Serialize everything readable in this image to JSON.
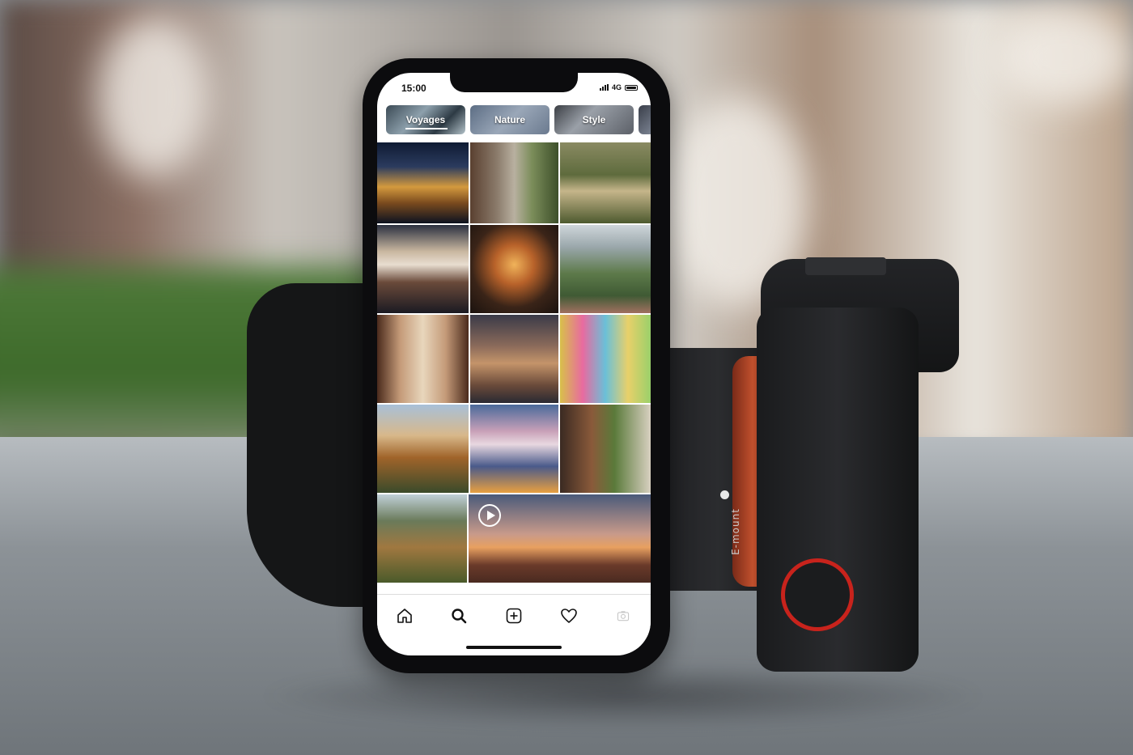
{
  "status_bar": {
    "time": "15:00",
    "network": "4G"
  },
  "topics": [
    {
      "label": "Voyages",
      "selected": true
    },
    {
      "label": "Nature",
      "selected": false
    },
    {
      "label": "Style",
      "selected": false
    },
    {
      "label": "",
      "selected": false
    }
  ],
  "grid": {
    "tiles": [
      {
        "name": "tile-1"
      },
      {
        "name": "tile-2"
      },
      {
        "name": "tile-3"
      },
      {
        "name": "tile-4"
      },
      {
        "name": "tile-5"
      },
      {
        "name": "tile-6"
      },
      {
        "name": "tile-7"
      },
      {
        "name": "tile-8"
      },
      {
        "name": "tile-9"
      },
      {
        "name": "tile-10"
      },
      {
        "name": "tile-11"
      },
      {
        "name": "tile-12"
      },
      {
        "name": "tile-13"
      },
      {
        "name": "tile-video",
        "is_video": true
      }
    ]
  },
  "tab_bar": {
    "items": [
      {
        "icon": "home-icon",
        "active": false
      },
      {
        "icon": "search-icon",
        "active": true
      },
      {
        "icon": "add-icon",
        "active": false
      },
      {
        "icon": "heart-icon",
        "active": false
      },
      {
        "icon": "profile-icon",
        "active": false
      }
    ]
  },
  "camera": {
    "mount_label": "E-mount"
  },
  "colors": {
    "ui_text": "#111111",
    "chip_text": "#ffffff",
    "dial_ring": "#c8231c",
    "lens_ring": "#c0502d"
  }
}
